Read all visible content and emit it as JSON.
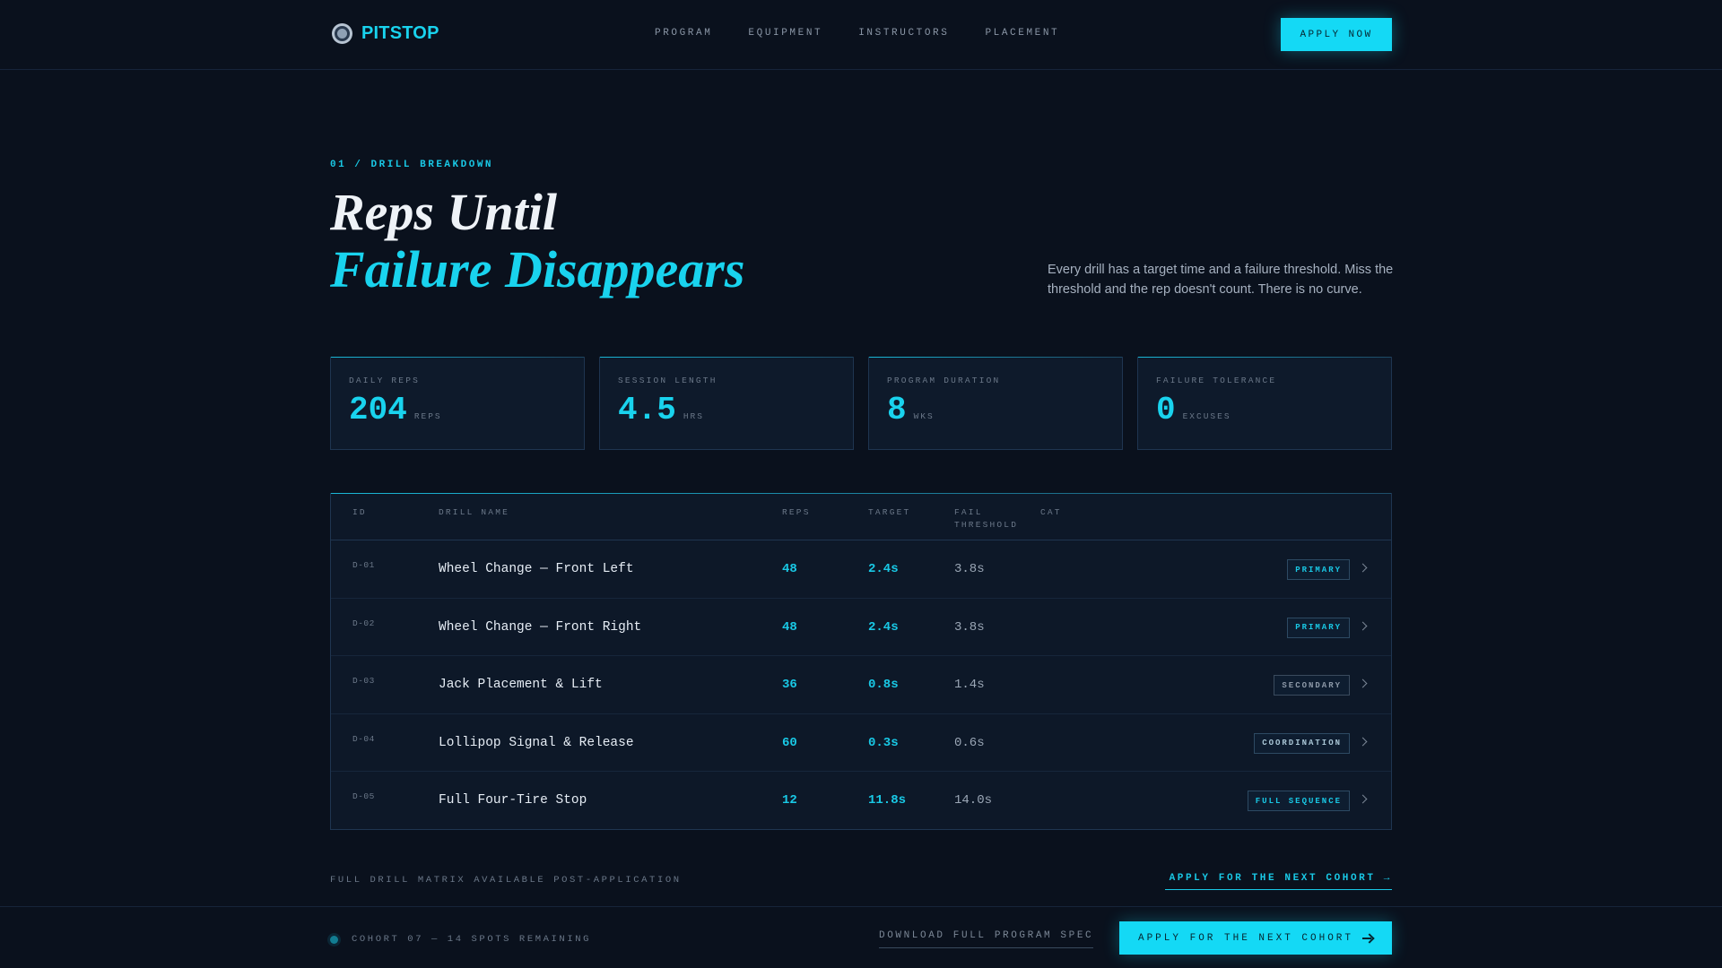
{
  "header": {
    "brand": "PITSTOP",
    "nav": [
      "PROGRAM",
      "EQUIPMENT",
      "INSTRUCTORS",
      "PLACEMENT"
    ],
    "cta": "APPLY NOW"
  },
  "hero": {
    "eyebrow": "01 / DRILL BREAKDOWN",
    "title_line1": "Reps Until",
    "title_line2": "Failure Disappears",
    "description": "Every drill has a target time and a failure threshold. Miss the threshold and the rep doesn't count. There is no curve."
  },
  "stats": [
    {
      "label": "DAILY REPS",
      "value": "204",
      "unit": "REPS"
    },
    {
      "label": "SESSION LENGTH",
      "value": "4.5",
      "unit": "HRS"
    },
    {
      "label": "PROGRAM DURATION",
      "value": "8",
      "unit": "WKS"
    },
    {
      "label": "FAILURE TOLERANCE",
      "value": "0",
      "unit": "EXCUSES"
    }
  ],
  "table": {
    "columns": {
      "id": "ID",
      "name": "DRILL NAME",
      "reps": "REPS",
      "target": "TARGET",
      "fail_1": "FAIL",
      "fail_2": "THRESHOLD",
      "cat": "CAT"
    },
    "rows": [
      {
        "id": "D-01",
        "name": "Wheel Change — Front Left",
        "reps": "48",
        "target": "2.4s",
        "fail": "3.8s",
        "cat": "PRIMARY"
      },
      {
        "id": "D-02",
        "name": "Wheel Change — Front Right",
        "reps": "48",
        "target": "2.4s",
        "fail": "3.8s",
        "cat": "PRIMARY"
      },
      {
        "id": "D-03",
        "name": "Jack Placement & Lift",
        "reps": "36",
        "target": "0.8s",
        "fail": "1.4s",
        "cat": "SECONDARY"
      },
      {
        "id": "D-04",
        "name": "Lollipop Signal & Release",
        "reps": "60",
        "target": "0.3s",
        "fail": "0.6s",
        "cat": "COORDINATION"
      },
      {
        "id": "D-05",
        "name": "Full Four-Tire Stop",
        "reps": "12",
        "target": "11.8s",
        "fail": "14.0s",
        "cat": "FULL SEQUENCE"
      }
    ]
  },
  "footer": {
    "matrix_note": "FULL DRILL MATRIX AVAILABLE POST-APPLICATION",
    "apply_link": "APPLY FOR THE NEXT COHORT →",
    "cohort_status": "COHORT 07 — 14 SPOTS REMAINING",
    "download": "DOWNLOAD FULL PROGRAM SPEC",
    "apply_button": "APPLY FOR THE NEXT COHORT"
  },
  "colors": {
    "accent": "#14d9f5",
    "background": "#0a111d",
    "panel": "#0e1a2b"
  }
}
